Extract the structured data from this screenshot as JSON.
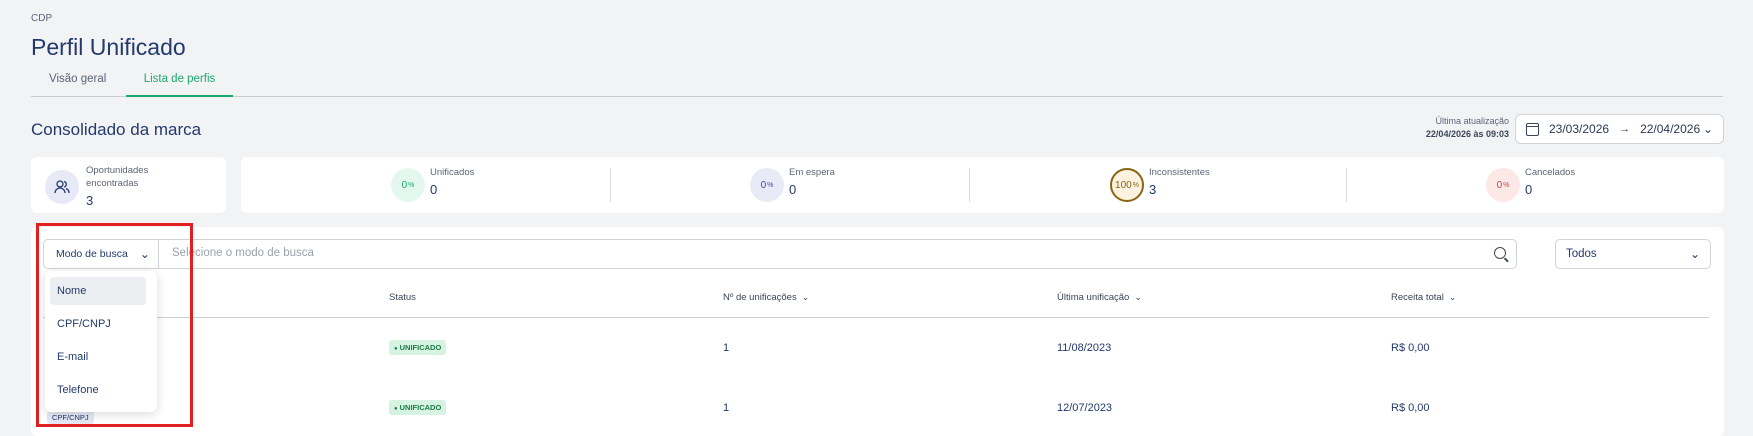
{
  "breadcrumb": "CDP",
  "page_title": "Perfil Unificado",
  "tabs": [
    {
      "label": "Visão geral",
      "active": false
    },
    {
      "label": "Lista de perfis",
      "active": true
    }
  ],
  "section_title": "Consolidado da marca",
  "last_update": {
    "label": "Última atualização",
    "value": "22/04/2026 às 09:03"
  },
  "date_range": {
    "start": "23/03/2026",
    "end": "22/04/2026"
  },
  "opportunities": {
    "label": "Oportunidades encontradas",
    "value": "3",
    "icon": "users-icon"
  },
  "stats": [
    {
      "name": "Unificados",
      "percent": "0",
      "unit": "%",
      "value": "0",
      "color": "#1fa86b",
      "bg": "#e3f7ee"
    },
    {
      "name": "Em espera",
      "percent": "0",
      "unit": "%",
      "value": "0",
      "color": "#3c4a9e",
      "bg": "#e8eaf7"
    },
    {
      "name": "Inconsistentes",
      "percent": "100",
      "unit": "%",
      "value": "3",
      "color": "#8a6412",
      "bg": "#fbf3df"
    },
    {
      "name": "Cancelados",
      "percent": "0",
      "unit": "%",
      "value": "0",
      "color": "#d64545",
      "bg": "#fde8e8"
    }
  ],
  "search": {
    "mode_label": "Modo de busca",
    "placeholder": "Selecione o modo de busca",
    "filter_value": "Todos"
  },
  "mode_options": [
    "Nome",
    "CPF/CNPJ",
    "E-mail",
    "Telefone"
  ],
  "selected_mode_option": "Nome",
  "table": {
    "headers": [
      "Status",
      "Nº de unificações",
      "Última unificação",
      "Receita total"
    ],
    "rows": [
      {
        "status": "UNIFICADO",
        "count": "1",
        "last": "11/08/2023",
        "revenue": "R$ 0,00"
      },
      {
        "status": "UNIFICADO",
        "count": "1",
        "last": "12/07/2023",
        "revenue": "R$ 0,00"
      }
    ],
    "row_chip": "CPF/CNPJ"
  }
}
